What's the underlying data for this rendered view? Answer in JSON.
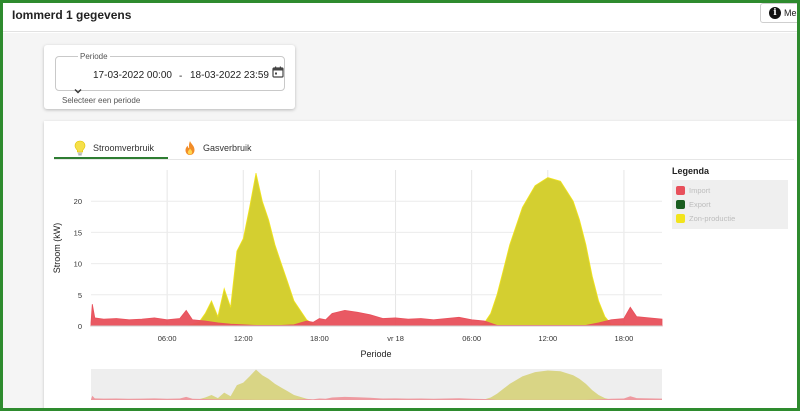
{
  "header": {
    "title": "Iommerd 1 gegevens",
    "menu_label": "Me",
    "menu_icon": "info-icon"
  },
  "period": {
    "label": "Periode",
    "from": "17-03-2022 00:00",
    "separator": "-",
    "to": "18-03-2022 23:59",
    "hint": "Selecteer een periode",
    "chevron_icon": "chevron-down-icon",
    "calendar_icon": "calendar-icon"
  },
  "tabs": [
    {
      "label": "Stroomverbruik",
      "icon": "lightbulb-icon",
      "active": true
    },
    {
      "label": "Gasverbruik",
      "icon": "flame-icon",
      "active": false
    }
  ],
  "legend": {
    "title": "Legenda",
    "items": [
      {
        "label": "Import",
        "color": "#e8505b"
      },
      {
        "label": "Export",
        "color": "#1b5e20"
      },
      {
        "label": "Zon-productie",
        "color": "#f2e41c"
      }
    ]
  },
  "chart_data": {
    "type": "area",
    "title": "",
    "xlabel": "Periode",
    "ylabel": "Stroom (kW)",
    "ylim": [
      0,
      25
    ],
    "yticks": [
      0,
      5,
      10,
      15,
      20
    ],
    "xlim": [
      0,
      45
    ],
    "xticks": [
      {
        "x": 6,
        "label": "06:00"
      },
      {
        "x": 12,
        "label": "12:00"
      },
      {
        "x": 18,
        "label": "18:00"
      },
      {
        "x": 24,
        "label": "vr 18"
      },
      {
        "x": 30,
        "label": "06:00"
      },
      {
        "x": 36,
        "label": "12:00"
      },
      {
        "x": 42,
        "label": "18:00"
      }
    ],
    "grid": true,
    "legend": "right",
    "series": [
      {
        "name": "Import",
        "color": "#e8505b",
        "x": [
          0,
          0.1,
          0.3,
          1,
          2,
          3,
          4,
          5,
          6,
          7,
          7.5,
          8,
          9,
          10,
          11,
          12,
          13,
          14,
          15,
          16,
          17,
          17.5,
          18,
          18.5,
          19,
          20,
          21,
          22,
          23,
          24,
          25,
          26,
          27,
          28,
          29,
          30,
          31,
          32,
          33,
          34,
          35,
          36,
          37,
          38,
          39,
          40,
          41,
          42,
          42.5,
          43,
          44,
          45
        ],
        "y": [
          0.5,
          3.5,
          1.3,
          1.1,
          1.2,
          1.0,
          1.1,
          1.3,
          1.0,
          1.2,
          2.5,
          1.0,
          0.8,
          0.5,
          0.3,
          0.2,
          0.1,
          0.1,
          0.1,
          0.2,
          0.8,
          0.6,
          1.2,
          1.0,
          2.0,
          2.5,
          2.2,
          1.8,
          1.2,
          1.3,
          1.1,
          1.2,
          1.0,
          1.2,
          1.4,
          1.0,
          0.8,
          0.1,
          0.1,
          0.1,
          0.1,
          0.1,
          0.1,
          0.1,
          0.1,
          0.5,
          1.0,
          1.2,
          3.0,
          1.5,
          1.3,
          1.1
        ]
      },
      {
        "name": "Zon-productie",
        "color": "#f2e41c",
        "x": [
          0,
          7.5,
          8.5,
          9,
          9.5,
          10,
          10.5,
          11,
          11.5,
          12,
          12.5,
          13,
          13.5,
          14,
          14.5,
          15,
          15.5,
          16,
          17,
          17.5,
          18,
          30.5,
          31,
          31.5,
          32,
          32.5,
          33,
          34,
          35,
          36,
          37,
          38,
          38.5,
          39,
          39.5,
          40,
          40.5,
          41,
          45
        ],
        "y": [
          0,
          0,
          0.6,
          2.0,
          4.0,
          1.5,
          6.0,
          3.0,
          12.0,
          14.0,
          19.0,
          24.5,
          20.0,
          17.0,
          13.0,
          10.0,
          7.0,
          4.0,
          1.0,
          0.3,
          0,
          0,
          0.5,
          2.0,
          5.0,
          9.0,
          13.0,
          19.0,
          22.5,
          23.8,
          23.2,
          20.0,
          17.0,
          13.0,
          8.0,
          4.0,
          1.5,
          0.3,
          0
        ]
      }
    ]
  }
}
